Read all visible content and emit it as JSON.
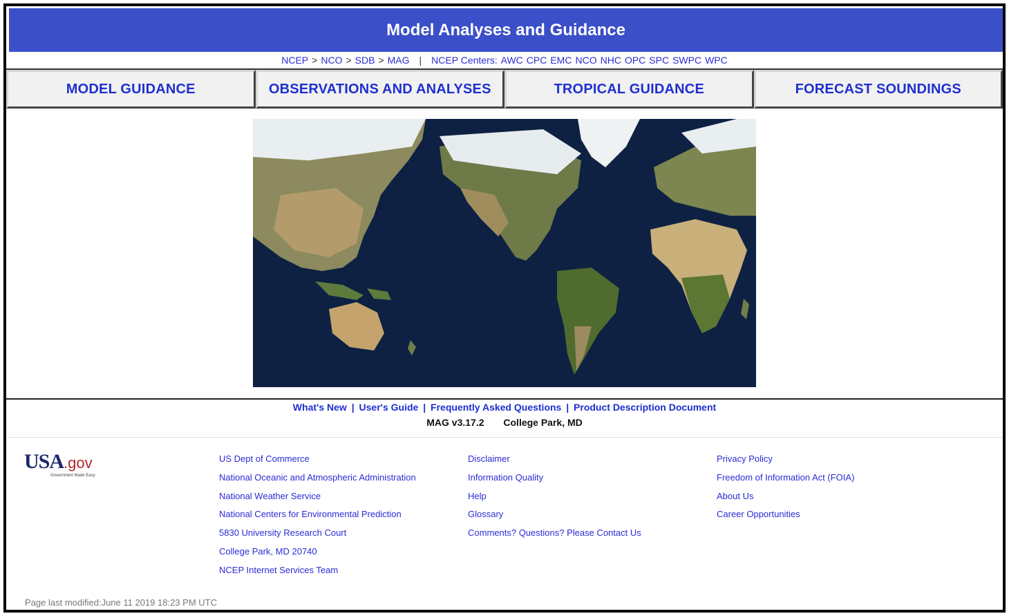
{
  "header": {
    "title": "Model Analyses and Guidance"
  },
  "breadcrumb": {
    "items": [
      "NCEP",
      "NCO",
      "SDB",
      "MAG"
    ],
    "separator": ">",
    "divider": "|",
    "centers_label": "NCEP Centers:",
    "centers": [
      "AWC",
      "CPC",
      "EMC",
      "NCO",
      "NHC",
      "OPC",
      "SPC",
      "SWPC",
      "WPC"
    ]
  },
  "tabs": [
    {
      "label": "MODEL GUIDANCE"
    },
    {
      "label": "OBSERVATIONS AND ANALYSES"
    },
    {
      "label": "TROPICAL GUIDANCE"
    },
    {
      "label": "FORECAST SOUNDINGS"
    }
  ],
  "links_row": [
    "What's New",
    "User's Guide",
    "Frequently Asked Questions",
    "Product Description Document"
  ],
  "version": {
    "text": "MAG v3.17.2",
    "location": "College Park, MD"
  },
  "logo": {
    "main": "USA",
    "suffix": ".gov",
    "tagline": "Government Made Easy"
  },
  "footer": {
    "col1": [
      "US Dept of Commerce",
      "National Oceanic and Atmospheric Administration",
      "National Weather Service",
      "National Centers for Environmental Prediction",
      "5830 University Research Court",
      "College Park, MD 20740",
      "NCEP Internet Services Team"
    ],
    "col2": [
      "Disclaimer",
      "Information Quality",
      "Help",
      "Glossary",
      "Comments? Questions? Please Contact Us"
    ],
    "col3": [
      "Privacy Policy",
      "Freedom of Information Act (FOIA)",
      "About Us",
      "Career Opportunities"
    ]
  },
  "last_modified": "Page last modified:June 11 2019 18:23 PM UTC",
  "colors": {
    "title_bg": "#3a4fc8",
    "link": "#2b2bd6",
    "tab_text": "#1f2fd0",
    "ocean": "#0e2143"
  }
}
